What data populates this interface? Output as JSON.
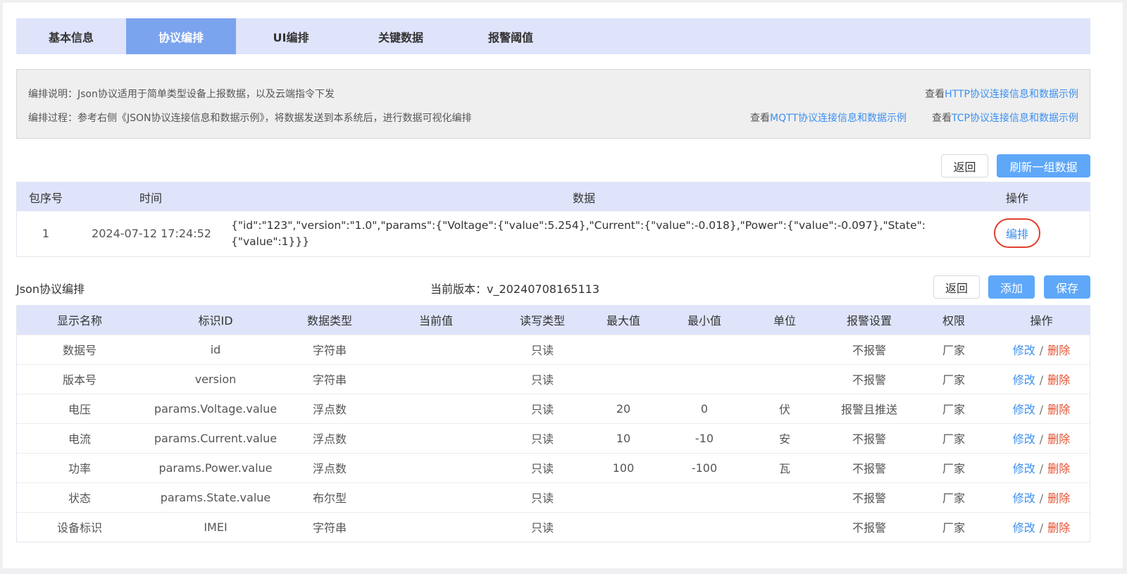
{
  "tabs": [
    "基本信息",
    "协议编排",
    "UI编排",
    "关键数据",
    "报警阈值"
  ],
  "info": {
    "line1": "编排说明：Json协议适用于简单类型设备上报数据，以及云端指令下发",
    "line2": "编排过程：参考右侧《JSON协议连接信息和数据示例》，将数据发送到本系统后，进行数据可视化编排",
    "view_prefix": "查看",
    "http_link": "HTTP协议连接信息和数据示例",
    "mqtt_link": "MQTT协议连接信息和数据示例",
    "tcp_link": "TCP协议连接信息和数据示例"
  },
  "top_buttons": {
    "back": "返回",
    "refresh": "刷新一组数据"
  },
  "packet_table": {
    "headers": {
      "seq": "包序号",
      "time": "时间",
      "data": "数据",
      "op": "操作"
    },
    "row": {
      "seq": "1",
      "time": "2024-07-12 17:24:52",
      "data": "{\"id\":\"123\",\"version\":\"1.0\",\"params\":{\"Voltage\":{\"value\":5.254},\"Current\":{\"value\":-0.018},\"Power\":{\"value\":-0.097},\"State\":{\"value\":1}}}",
      "op": "编排"
    }
  },
  "json_section": {
    "title": "Json协议编排",
    "version_label": "当前版本：",
    "version_value": "v_20240708165113",
    "back": "返回",
    "add": "添加",
    "save": "保存"
  },
  "main_table": {
    "headers": [
      "显示名称",
      "标识ID",
      "数据类型",
      "当前值",
      "读写类型",
      "最大值",
      "最小值",
      "单位",
      "报警设置",
      "权限",
      "操作"
    ],
    "op_modify": "修改",
    "op_sep": "/",
    "op_delete": "删除",
    "rows": [
      [
        "数据号",
        "id",
        "字符串",
        "",
        "只读",
        "",
        "",
        "",
        "不报警",
        "厂家"
      ],
      [
        "版本号",
        "version",
        "字符串",
        "",
        "只读",
        "",
        "",
        "",
        "不报警",
        "厂家"
      ],
      [
        "电压",
        "params.Voltage.value",
        "浮点数",
        "",
        "只读",
        "20",
        "0",
        "伏",
        "报警且推送",
        "厂家"
      ],
      [
        "电流",
        "params.Current.value",
        "浮点数",
        "",
        "只读",
        "10",
        "-10",
        "安",
        "不报警",
        "厂家"
      ],
      [
        "功率",
        "params.Power.value",
        "浮点数",
        "",
        "只读",
        "100",
        "-100",
        "瓦",
        "不报警",
        "厂家"
      ],
      [
        "状态",
        "params.State.value",
        "布尔型",
        "",
        "只读",
        "",
        "",
        "",
        "不报警",
        "厂家"
      ],
      [
        "设备标识",
        "IMEI",
        "字符串",
        "",
        "只读",
        "",
        "",
        "",
        "不报警",
        "厂家"
      ]
    ]
  }
}
